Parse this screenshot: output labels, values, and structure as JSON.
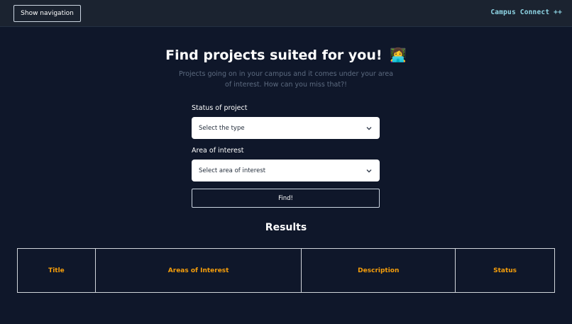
{
  "header": {
    "nav_button_label": "Show navigation",
    "brand": "Campus Connect ++"
  },
  "main": {
    "title": "Find projects suited for you!",
    "title_emoji": "👩‍💻",
    "subtitle": "Projects going on in your campus and it comes under your area of interest. How can you miss that?!",
    "status_label": "Status of project",
    "status_selected": "Select the type",
    "interest_label": "Area of interest",
    "interest_selected": "Select area of interest",
    "find_label": "Find!",
    "results_title": "Results",
    "table_headers": [
      "Title",
      "Areas of Interest",
      "Description",
      "Status"
    ]
  },
  "colors": {
    "background": "#0f172a",
    "topbar": "#1b2330",
    "brand": "#8fd6e6",
    "header_accent": "#f59e0b"
  }
}
